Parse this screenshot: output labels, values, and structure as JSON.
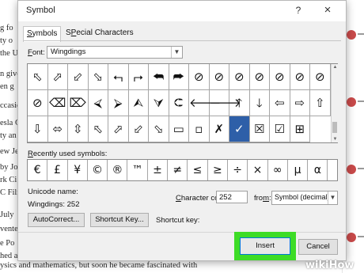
{
  "background": {
    "lines": [
      "g fo",
      "ty o",
      "the U",
      "n give",
      "en g",
      "ccasio",
      "esla C",
      "ty an",
      "ew Je",
      "by Jo",
      "rk Ci",
      "C Film",
      "July",
      "vente",
      "e Po",
      "hed a"
    ],
    "bottom_text": "ysics and mathematics, but soon he became fascinated with",
    "accent_color": "#c94a4a"
  },
  "dialog": {
    "title": "Symbol",
    "help": "?",
    "close": "×",
    "tabs": [
      {
        "label": "Symbols",
        "u": "S",
        "rest": "ymbols"
      },
      {
        "label": "Special Characters",
        "u": "P",
        "pre": "S",
        "rest": "ecial Characters"
      }
    ],
    "font_label_u": "F",
    "font_label_rest": "ont:",
    "font_value": "Wingdings",
    "grid_rows": [
      [
        "⬁",
        "⬀",
        "⬃",
        "⬂",
        "⮢",
        "⮣",
        "⮪",
        "⮫",
        "⊘",
        "⊘",
        "⊘",
        "⊘",
        "⊘",
        "⊘",
        "⊘"
      ],
      [
        "⊘",
        "⌫",
        "⌦",
        "⮘",
        "⮚",
        "⮙",
        "⮛",
        "⮈",
        "🡐",
        "🡒",
        "🡑",
        "🡓",
        "⇦",
        "⇨",
        "⇧"
      ],
      [
        "⇩",
        "⬄",
        "⇳",
        "⬁",
        "⬀",
        "⬃",
        "⬂",
        "▭",
        "▫",
        "✗",
        "✓",
        "☒",
        "☑",
        "⊞"
      ]
    ],
    "selected_symbol": "✓",
    "recent_label_u": "R",
    "recent_label_rest": "ecently used symbols:",
    "recent": [
      "€",
      "£",
      "¥",
      "©",
      "®",
      "™",
      "±",
      "≠",
      "≤",
      "≥",
      "÷",
      "×",
      "∞",
      "µ",
      "α"
    ],
    "unicode_name_label": "Unicode name:",
    "unicode_value": "Wingdings: 252",
    "char_code_label_u": "C",
    "char_code_label_rest": "haracter code:",
    "char_code_value": "252",
    "from_label_u": "m",
    "from_label_pre": "fro",
    "from_label_rest": ":",
    "from_value": "Symbol (decimal)",
    "autocorrect_label": "AutoCorrect...",
    "shortcut_key_button": "Shortcut Key...",
    "shortcut_key_label": "Shortcut key:",
    "insert_label": "Insert",
    "cancel_label": "Cancel",
    "selection_color": "#2e5fa8",
    "highlight_color": "#3ddc26"
  },
  "watermark": {
    "wiki": "wiki",
    "how": "How"
  }
}
